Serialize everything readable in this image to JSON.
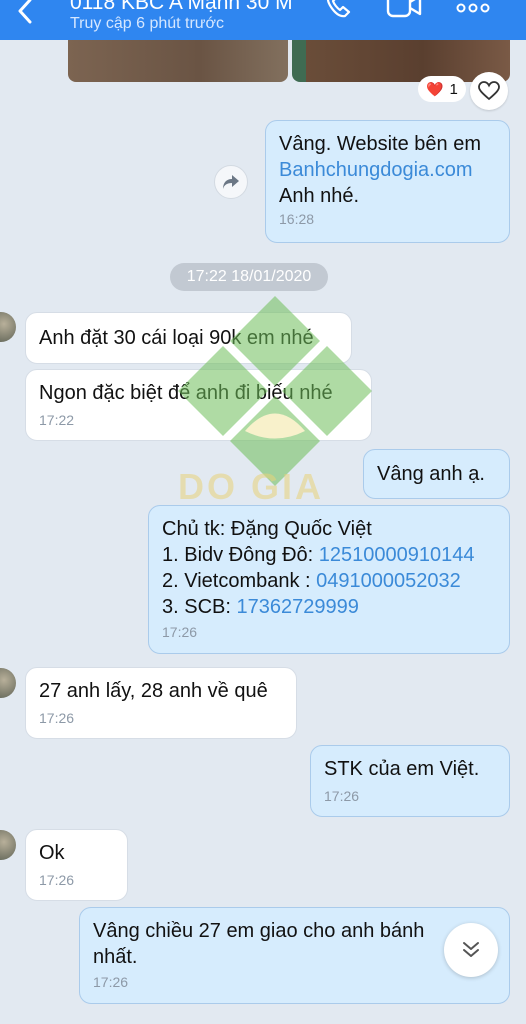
{
  "header": {
    "title": "0118 KBC A Mạnh 30 M",
    "subtitle": "Truy cập 6 phút trước"
  },
  "reaction": {
    "emoji": "❤️",
    "count": "1"
  },
  "messages": [
    {
      "direction": "out",
      "lines": [
        "Vâng. Website bên em"
      ],
      "link": "Banhchungdogia.com",
      "after": "Anh nhé.",
      "time": "16:28"
    },
    {
      "direction": "in",
      "text": "Anh đặt 30 cái loại 90k em nhé"
    },
    {
      "direction": "in",
      "text": "Ngon đặc biệt để anh đi biếu nhé",
      "time": "17:22"
    },
    {
      "direction": "out",
      "text": "Vâng anh ạ."
    },
    {
      "direction": "out",
      "line1": "Chủ tk: Đặng Quốc Việt",
      "accounts": [
        {
          "label": "1. Bidv Đông Đô: ",
          "number": "12510000910144"
        },
        {
          "label": "2. Vietcombank : ",
          "number": "0491000052032"
        },
        {
          "label": "3. SCB: ",
          "number": "17362729999"
        }
      ],
      "time": "17:26"
    },
    {
      "direction": "in",
      "text": "27 anh lấy, 28 anh về quê",
      "time": "17:26"
    },
    {
      "direction": "out",
      "text": "STK của em Việt.",
      "time": "17:26"
    },
    {
      "direction": "in",
      "text": "Ok",
      "time": "17:26"
    },
    {
      "direction": "out",
      "text": "Vâng chiều 27 em giao cho anh bánh",
      "text2": "nhất.",
      "time": "17:26"
    }
  ],
  "date_divider": "17:22 18/01/2020",
  "watermark": {
    "text": "DO GIA"
  },
  "colors": {
    "header": "#2f86f0",
    "outgoing": "#d6ecfd",
    "incoming": "#ffffff",
    "link": "#3b8ad8",
    "background": "#e2e9f1"
  },
  "icons": [
    "back-chevron-icon",
    "phone-icon",
    "video-call-icon",
    "more-icon",
    "heart-outline-icon",
    "forward-share-icon",
    "scroll-down-icon"
  ]
}
